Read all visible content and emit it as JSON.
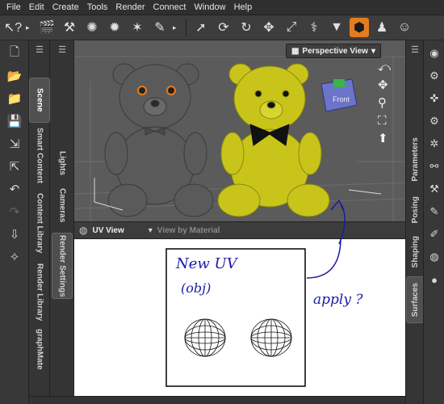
{
  "menu": [
    "File",
    "Edit",
    "Create",
    "Tools",
    "Render",
    "Connect",
    "Window",
    "Help"
  ],
  "toolbar_icons": [
    "query-icon",
    "scene-icon",
    "wand-icon",
    "sparkle-icon",
    "light-icon",
    "star-icon",
    "brush-icon",
    "pointer-icon",
    "rotate-icon",
    "spin-icon",
    "move-icon",
    "scale-icon",
    "bone-icon",
    "cone-icon",
    "paint-bucket-icon",
    "figure-icon",
    "person-icon"
  ],
  "left_tabs": [
    "Scene",
    "Smart Content",
    "Content Library",
    "Render Library",
    "graphMate"
  ],
  "second_tabs": [
    "Lights",
    "Cameras",
    "Render Settings"
  ],
  "viewport": {
    "view_label": "Perspective View",
    "cube_label": "Front"
  },
  "uv_panel": {
    "label": "UV View",
    "material_label": "View by Material"
  },
  "right_tabs": [
    "Parameters",
    "Posing",
    "Shaping",
    "Surfaces"
  ],
  "annotations": {
    "note1": "New UV",
    "note2": "(obj)",
    "note3": "apply ?"
  },
  "colors": {
    "accent": "#e37c20",
    "yellow_bear": "#c8c41a",
    "gray_bear": "#5a5a5a",
    "annotation_ink": "#1a1aa8"
  }
}
